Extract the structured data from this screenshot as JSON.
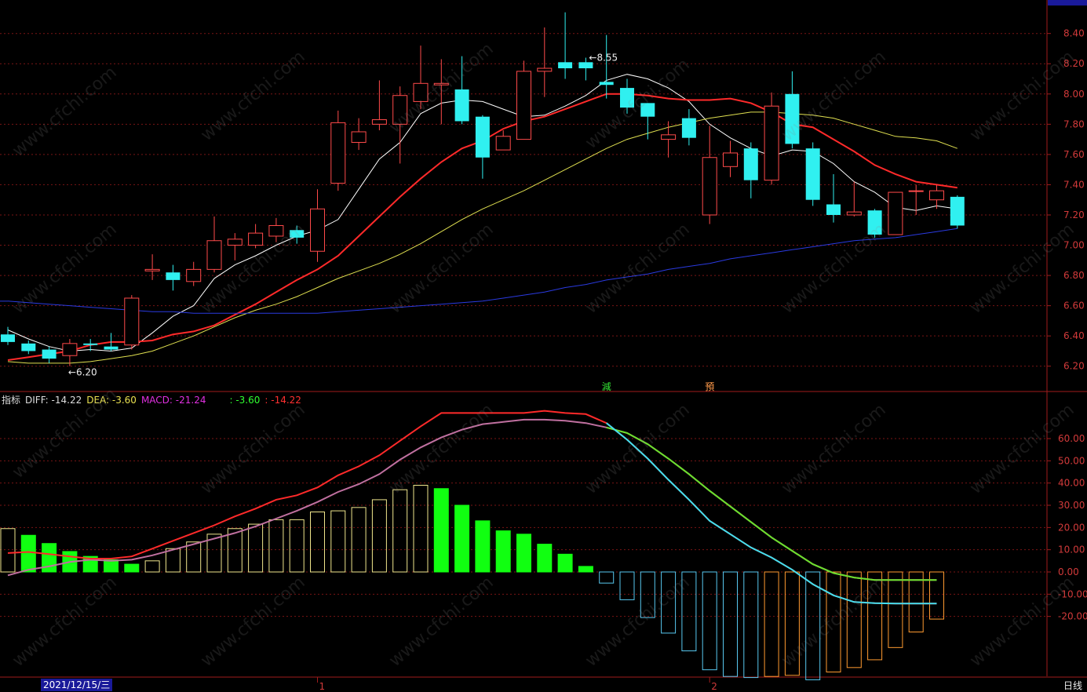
{
  "chart_data": [
    {
      "type": "candlestick",
      "ylim": [
        6.1,
        8.58
      ],
      "yticks": [
        "8.40",
        "8.20",
        "8.00",
        "7.80",
        "7.60",
        "7.40",
        "7.20",
        "7.00",
        "6.80",
        "6.60",
        "6.40",
        "6.20"
      ],
      "annotations": [
        {
          "text": "8.55",
          "candle": 28
        },
        {
          "text": "6.20",
          "candle": 3
        }
      ],
      "candles": [
        {
          "o": 6.41,
          "c": 6.36,
          "h": 6.46,
          "l": 6.34
        },
        {
          "o": 6.35,
          "c": 6.3,
          "h": 6.37,
          "l": 6.28
        },
        {
          "o": 6.31,
          "c": 6.25,
          "h": 6.33,
          "l": 6.22
        },
        {
          "o": 6.27,
          "c": 6.35,
          "h": 6.38,
          "l": 6.2
        },
        {
          "o": 6.35,
          "c": 6.34,
          "h": 6.38,
          "l": 6.3
        },
        {
          "o": 6.33,
          "c": 6.31,
          "h": 6.42,
          "l": 6.3
        },
        {
          "o": 6.34,
          "c": 6.65,
          "h": 6.67,
          "l": 6.31
        },
        {
          "o": 6.83,
          "c": 6.84,
          "h": 6.94,
          "l": 6.77
        },
        {
          "o": 6.82,
          "c": 6.77,
          "h": 6.87,
          "l": 6.7
        },
        {
          "o": 6.76,
          "c": 6.84,
          "h": 6.89,
          "l": 6.73
        },
        {
          "o": 6.84,
          "c": 7.03,
          "h": 7.19,
          "l": 6.82
        },
        {
          "o": 7.0,
          "c": 7.04,
          "h": 7.08,
          "l": 6.9
        },
        {
          "o": 7.0,
          "c": 7.08,
          "h": 7.14,
          "l": 6.98
        },
        {
          "o": 7.06,
          "c": 7.13,
          "h": 7.18,
          "l": 7.02
        },
        {
          "o": 7.1,
          "c": 7.05,
          "h": 7.13,
          "l": 7.01
        },
        {
          "o": 6.96,
          "c": 7.24,
          "h": 7.37,
          "l": 6.89
        },
        {
          "o": 7.41,
          "c": 7.81,
          "h": 7.89,
          "l": 7.36
        },
        {
          "o": 7.68,
          "c": 7.75,
          "h": 7.84,
          "l": 7.63
        },
        {
          "o": 7.8,
          "c": 7.83,
          "h": 8.09,
          "l": 7.76
        },
        {
          "o": 7.8,
          "c": 7.99,
          "h": 8.05,
          "l": 7.54
        },
        {
          "o": 7.95,
          "c": 8.07,
          "h": 8.32,
          "l": 7.9
        },
        {
          "o": 8.06,
          "c": 8.07,
          "h": 8.23,
          "l": 7.8
        },
        {
          "o": 8.03,
          "c": 7.82,
          "h": 8.25,
          "l": 7.8
        },
        {
          "o": 7.85,
          "c": 7.58,
          "h": 7.86,
          "l": 7.44
        },
        {
          "o": 7.63,
          "c": 7.72,
          "h": 7.76,
          "l": 7.63
        },
        {
          "o": 7.7,
          "c": 8.15,
          "h": 8.22,
          "l": 7.7
        },
        {
          "o": 8.15,
          "c": 8.17,
          "h": 8.44,
          "l": 7.98
        },
        {
          "o": 8.21,
          "c": 8.17,
          "h": 8.54,
          "l": 8.1
        },
        {
          "o": 8.21,
          "c": 8.17,
          "h": 8.24,
          "l": 8.09
        },
        {
          "o": 8.08,
          "c": 8.06,
          "h": 8.39,
          "l": 7.97
        },
        {
          "o": 8.04,
          "c": 7.91,
          "h": 8.1,
          "l": 7.87
        },
        {
          "o": 7.94,
          "c": 7.85,
          "h": 7.94,
          "l": 7.7
        },
        {
          "o": 7.7,
          "c": 7.73,
          "h": 7.82,
          "l": 7.58
        },
        {
          "o": 7.84,
          "c": 7.71,
          "h": 7.9,
          "l": 7.66
        },
        {
          "o": 7.2,
          "c": 7.58,
          "h": 7.79,
          "l": 7.14
        },
        {
          "o": 7.52,
          "c": 7.61,
          "h": 7.69,
          "l": 7.45
        },
        {
          "o": 7.64,
          "c": 7.43,
          "h": 7.68,
          "l": 7.31
        },
        {
          "o": 7.43,
          "c": 7.92,
          "h": 8.01,
          "l": 7.4
        },
        {
          "o": 8.0,
          "c": 7.67,
          "h": 8.15,
          "l": 7.64
        },
        {
          "o": 7.64,
          "c": 7.3,
          "h": 7.68,
          "l": 7.26
        },
        {
          "o": 7.27,
          "c": 7.2,
          "h": 7.47,
          "l": 7.15
        },
        {
          "o": 7.2,
          "c": 7.22,
          "h": 7.42,
          "l": 7.19
        },
        {
          "o": 7.23,
          "c": 7.07,
          "h": 7.24,
          "l": 7.05
        },
        {
          "o": 7.07,
          "c": 7.35,
          "h": 7.35,
          "l": 7.07
        },
        {
          "o": 7.36,
          "c": 7.36,
          "h": 7.4,
          "l": 7.2
        },
        {
          "o": 7.3,
          "c": 7.36,
          "h": 7.4,
          "l": 7.24
        },
        {
          "o": 7.32,
          "c": 7.13,
          "h": 7.33,
          "l": 7.11
        }
      ],
      "ma": [
        {
          "color": "#ffffff",
          "values": [
            6.44,
            6.38,
            6.33,
            6.3,
            6.31,
            6.3,
            6.32,
            6.42,
            6.53,
            6.6,
            6.78,
            6.87,
            6.93,
            7.0,
            7.06,
            7.1,
            7.17,
            7.37,
            7.57,
            7.68,
            7.87,
            7.94,
            7.96,
            7.95,
            7.9,
            7.85,
            7.86,
            7.92,
            7.99,
            8.09,
            8.13,
            8.1,
            8.04,
            7.95,
            7.8,
            7.71,
            7.64,
            7.59,
            7.63,
            7.62,
            7.54,
            7.42,
            7.35,
            7.25,
            7.23,
            7.26,
            7.24
          ]
        },
        {
          "color": "#ff2a2a",
          "values": [
            6.24,
            6.26,
            6.28,
            6.3,
            6.34,
            6.36,
            6.36,
            6.37,
            6.41,
            6.43,
            6.47,
            6.54,
            6.61,
            6.69,
            6.77,
            6.84,
            6.93,
            7.06,
            7.19,
            7.32,
            7.44,
            7.55,
            7.64,
            7.69,
            7.77,
            7.82,
            7.85,
            7.9,
            7.95,
            8.0,
            8.0,
            7.99,
            7.97,
            7.96,
            7.96,
            7.97,
            7.94,
            7.88,
            7.8,
            7.78,
            7.7,
            7.62,
            7.53,
            7.47,
            7.42,
            7.4,
            7.38
          ]
        },
        {
          "color": "#e0e050",
          "values": [
            6.23,
            6.22,
            6.22,
            6.22,
            6.23,
            6.25,
            6.27,
            6.3,
            6.35,
            6.4,
            6.46,
            6.52,
            6.57,
            6.61,
            6.66,
            6.72,
            6.78,
            6.83,
            6.88,
            6.94,
            7.01,
            7.09,
            7.17,
            7.24,
            7.3,
            7.36,
            7.43,
            7.5,
            7.57,
            7.64,
            7.7,
            7.74,
            7.78,
            7.81,
            7.84,
            7.86,
            7.88,
            7.88,
            7.87,
            7.86,
            7.84,
            7.8,
            7.76,
            7.72,
            7.71,
            7.69,
            7.64
          ]
        },
        {
          "color": "#2a3ae0",
          "values": [
            6.63,
            6.62,
            6.61,
            6.6,
            6.59,
            6.58,
            6.57,
            6.56,
            6.56,
            6.55,
            6.55,
            6.55,
            6.55,
            6.55,
            6.55,
            6.55,
            6.56,
            6.57,
            6.58,
            6.59,
            6.6,
            6.61,
            6.62,
            6.63,
            6.65,
            6.67,
            6.69,
            6.72,
            6.74,
            6.77,
            6.79,
            6.81,
            6.84,
            6.86,
            6.88,
            6.91,
            6.93,
            6.95,
            6.97,
            6.99,
            7.01,
            7.03,
            7.04,
            7.05,
            7.07,
            7.09,
            7.11
          ]
        }
      ],
      "signals": [
        {
          "text": "減",
          "candle": 29,
          "color": "#34e434"
        },
        {
          "text": "預",
          "candle": 34,
          "color": "#ff9a4a"
        }
      ]
    },
    {
      "type": "bar",
      "indicator": "MACD",
      "ylim": [
        -46,
        77
      ],
      "yticks": [
        "60.00",
        "50.00",
        "40.00",
        "30.00",
        "20.00",
        "10.00",
        "0.00",
        "-10.00",
        "-20.00"
      ],
      "legend": {
        "prefix": "指标",
        "diff": "DIFF: -14.22",
        "dea": "DEA: -3.60",
        "macd": "MACD: -21.24",
        "extra1": ": -3.60",
        "extra2": ": -14.22"
      },
      "macd": [
        19.5,
        16.5,
        12.8,
        9.2,
        7.0,
        5.5,
        3.5,
        5.0,
        10.5,
        13.5,
        17.0,
        19.5,
        21.5,
        23.5,
        23.5,
        27.0,
        27.5,
        29.0,
        32.5,
        37.0,
        39.0,
        37.5,
        30.0,
        23.0,
        18.5,
        17.0,
        12.5,
        8.0,
        2.5,
        -5.0,
        -12.5,
        -20.5,
        -27.5,
        -35.5,
        -44.0,
        -47.0,
        -47.5,
        -47.0,
        -46.5,
        -48.5,
        -45.0,
        -43.0,
        -39.5,
        -34.0,
        -27.0,
        -21.2
      ],
      "diff": [
        8.5,
        9.0,
        8.0,
        7.0,
        6.0,
        6.0,
        7.0,
        10.5,
        14.0,
        17.5,
        21.0,
        25.0,
        28.5,
        32.5,
        34.5,
        38.0,
        43.5,
        47.5,
        52.5,
        59.0,
        65.5,
        71.5,
        71.5,
        71.5,
        71.5,
        71.5,
        72.5,
        71.5,
        71.0,
        67.0,
        59.5,
        51.0,
        41.5,
        32.5,
        23.0,
        17.0,
        11.0,
        6.5,
        1.0,
        -5.5,
        -10.5,
        -13.5,
        -14.0,
        -14.2,
        -14.2,
        -14.22
      ],
      "dea": [
        -1.5,
        1.0,
        2.5,
        4.5,
        5.5,
        5.0,
        5.5,
        7.5,
        10.0,
        12.5,
        15.0,
        17.5,
        20.5,
        24.0,
        27.5,
        31.5,
        36.0,
        39.5,
        44.0,
        50.5,
        56.0,
        60.5,
        64.0,
        66.5,
        67.5,
        68.5,
        68.5,
        68.0,
        67.0,
        65.0,
        62.5,
        57.5,
        51.0,
        44.0,
        36.5,
        29.5,
        22.5,
        15.5,
        9.5,
        3.5,
        -0.5,
        -2.5,
        -3.6,
        -3.6,
        -3.6,
        -3.6
      ]
    }
  ],
  "xaxis": {
    "date_label": "2021/12/15/三",
    "month_marks": [
      {
        "text": "1",
        "candle": 15
      },
      {
        "text": "2",
        "candle": 34
      }
    ]
  },
  "period_button": "日线",
  "watermark": "www.cfchi.com",
  "colors": {
    "up": "#ff4a4a",
    "down": "#30f0f0",
    "macd_pos_up": "#f0e68c",
    "macd_pos_down": "#11ff11",
    "macd_neg_down": "#58c8f0",
    "macd_neg_up": "#ff9a30",
    "diff": "#ff2a2a",
    "dea": "#c070a0",
    "grid": "#7a1515",
    "frame": "#a01c1c"
  }
}
